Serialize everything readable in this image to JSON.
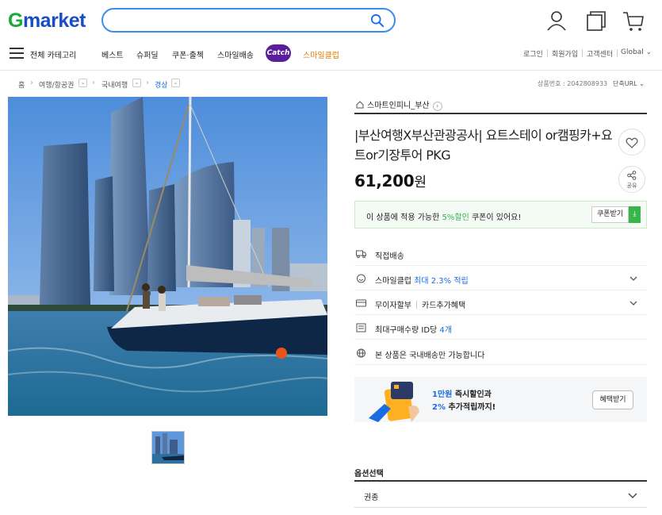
{
  "header": {
    "logo_g": "G",
    "logo_rest": "market",
    "search_placeholder": "",
    "icons": [
      "search-icon",
      "user-icon",
      "recent-view-icon",
      "cart-icon"
    ]
  },
  "nav": {
    "all_categories": "전체 카테고리",
    "items": [
      "베스트",
      "슈퍼딜",
      "쿠폰·출첵",
      "스마일배송"
    ],
    "catch_label": "Catch",
    "smile_club": "스마일클럽",
    "util": [
      "로그인",
      "회원가입",
      "고객센터",
      "Global"
    ]
  },
  "breadcrumb": {
    "items": [
      "홈",
      "여행/항공권",
      "국내여행",
      "경상"
    ],
    "product_no": "상품번호 : 2042808933",
    "short_url": "단축URL"
  },
  "product": {
    "shop_name": "스마트인피니_부산",
    "title": "|부산여행X부산관광공사| 요트스테이 or캠핑카+요트or기장투어 PKG",
    "price": "61,200",
    "price_unit": "원",
    "share_label": "공유"
  },
  "coupon": {
    "text_before": "이 상품에 적용 가능한 ",
    "highlight": "5%할인",
    "text_after": " 쿠폰이 있어요!",
    "button": "쿠폰받기"
  },
  "info": {
    "delivery": "직접배송",
    "smileclub_label": "스마일클럽 ",
    "smileclub_value": "최대 2.3% 적립",
    "installment": "무이자할부",
    "card_benefit": "카드추가혜택",
    "max_qty_label": "최대구매수량 ID당 ",
    "max_qty_value": "4개",
    "domestic": "본 상품은 국내배송만 가능합니다"
  },
  "promo": {
    "line1_hl": "1만원",
    "line1_rest": " 즉시할인과",
    "line2_hl": "2%",
    "line2_rest": " 추가적립까지!",
    "button": "혜택받기"
  },
  "option": {
    "label": "옵션선택",
    "value": "권종"
  },
  "colors": {
    "logo_green": "#1aaa36",
    "logo_blue": "#1a4dc4",
    "search_border": "#3b8ef0",
    "accent_blue": "#1a6de0",
    "coupon_green": "#39b54a",
    "catch_purple": "#5a1d9c",
    "smile_club_orange": "#e07b00"
  }
}
